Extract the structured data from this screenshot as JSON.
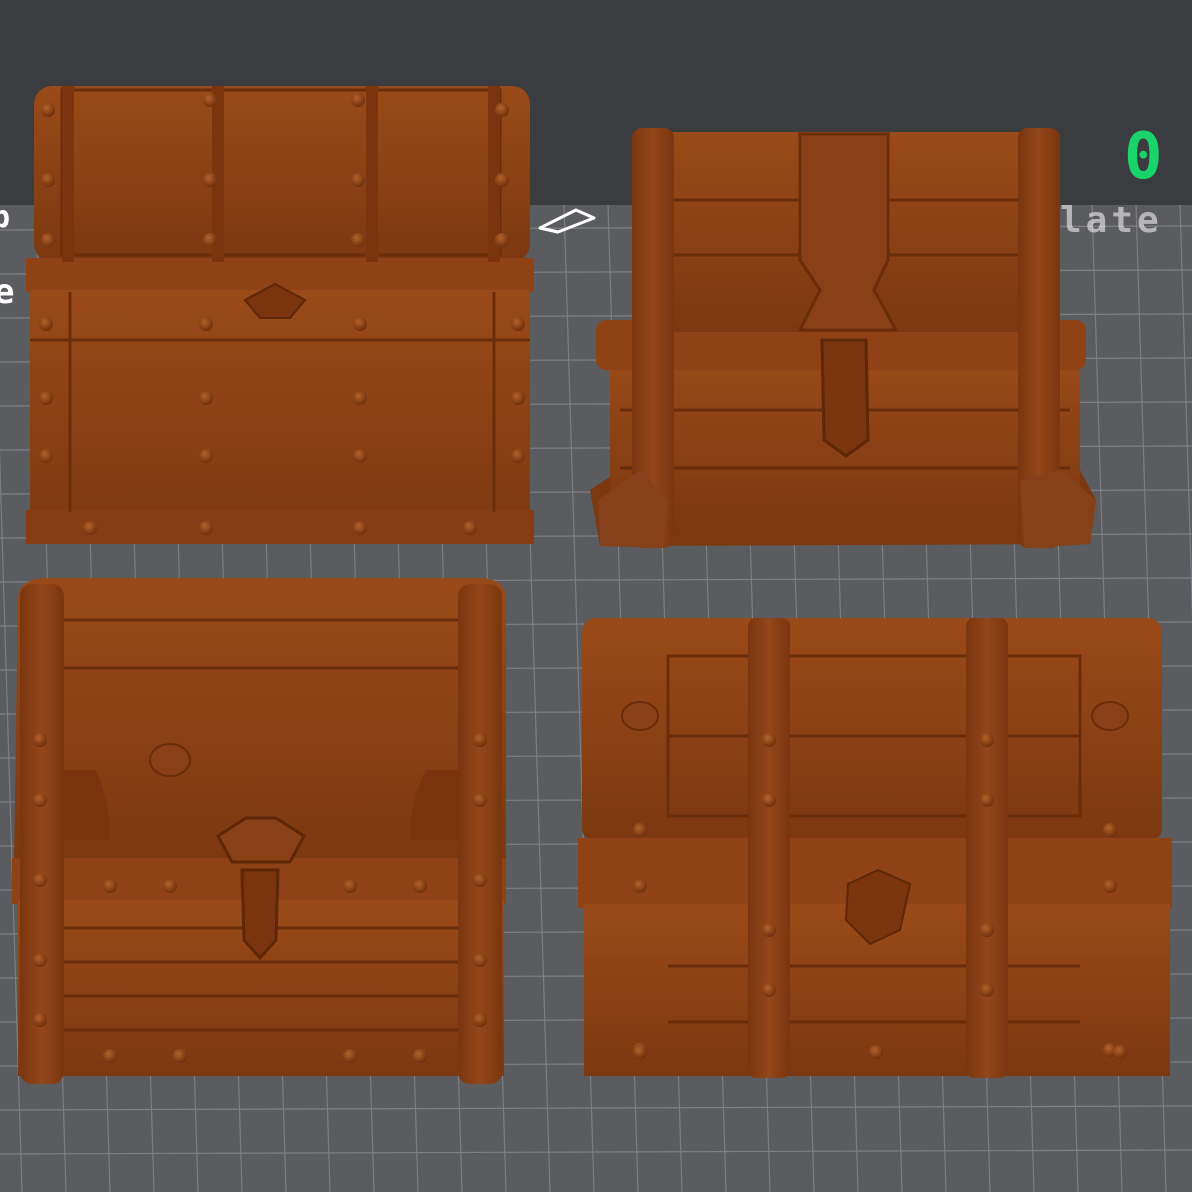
{
  "colors": {
    "background": "#5b5c60",
    "grid_line": "#7d7f84",
    "grid_major": "#8a8c92",
    "top_bar": "#3b3c40",
    "model": "#8a3f12",
    "model_shade": "#6d2f0b",
    "model_highlight": "#a55420",
    "accent_green": "#19d46a"
  },
  "overlay": {
    "left_fragment": "p",
    "left_fragment_2": "e",
    "right_fragment": "late",
    "counter_fragment": "0"
  },
  "icons": {
    "cut_icon": "cut-tool-icon"
  },
  "models": [
    {
      "name": "treasure-chest-studded"
    },
    {
      "name": "treasure-chest-strapped"
    },
    {
      "name": "treasure-chest-rounded"
    },
    {
      "name": "treasure-chest-banded"
    }
  ]
}
